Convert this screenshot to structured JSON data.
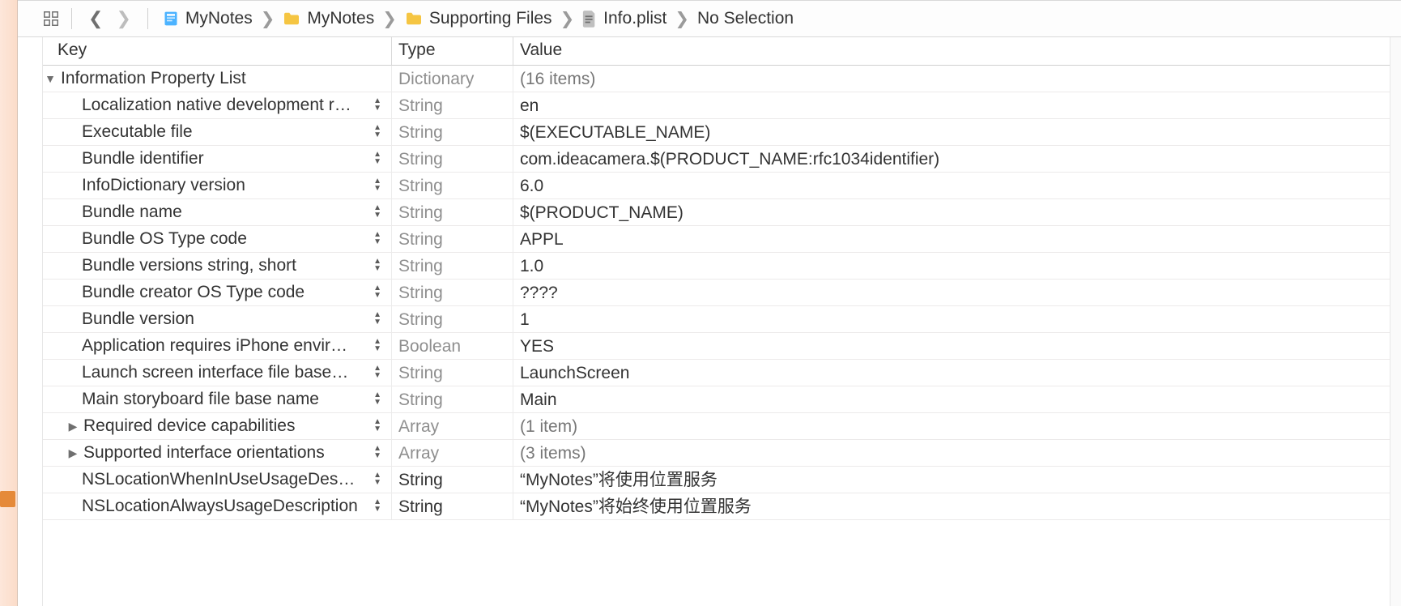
{
  "jumpbar": {
    "project": "MyNotes",
    "group": "MyNotes",
    "subgroup": "Supporting Files",
    "file": "Info.plist",
    "selection": "No Selection"
  },
  "columns": {
    "key": "Key",
    "type": "Type",
    "value": "Value"
  },
  "root": {
    "key": "Information Property List",
    "type": "Dictionary",
    "value": "(16 items)"
  },
  "rows": [
    {
      "key": "Localization native development r…",
      "type": "String",
      "value": "en",
      "stepper": true
    },
    {
      "key": "Executable file",
      "type": "String",
      "value": "$(EXECUTABLE_NAME)",
      "stepper": true
    },
    {
      "key": "Bundle identifier",
      "type": "String",
      "value": "com.ideacamera.$(PRODUCT_NAME:rfc1034identifier)",
      "stepper": true
    },
    {
      "key": "InfoDictionary version",
      "type": "String",
      "value": "6.0",
      "stepper": true
    },
    {
      "key": "Bundle name",
      "type": "String",
      "value": "$(PRODUCT_NAME)",
      "stepper": true
    },
    {
      "key": "Bundle OS Type code",
      "type": "String",
      "value": "APPL",
      "stepper": true
    },
    {
      "key": "Bundle versions string, short",
      "type": "String",
      "value": "1.0",
      "stepper": true
    },
    {
      "key": "Bundle creator OS Type code",
      "type": "String",
      "value": "????",
      "stepper": true
    },
    {
      "key": "Bundle version",
      "type": "String",
      "value": "1",
      "stepper": true
    },
    {
      "key": "Application requires iPhone envir…",
      "type": "Boolean",
      "value": "YES",
      "stepper": true
    },
    {
      "key": "Launch screen interface file base…",
      "type": "String",
      "value": "LaunchScreen",
      "stepper": true
    },
    {
      "key": "Main storyboard file base name",
      "type": "String",
      "value": "Main",
      "stepper": true
    },
    {
      "key": "Required device capabilities",
      "type": "Array",
      "value": "(1 item)",
      "stepper": true,
      "disclosure": "right",
      "muted": true
    },
    {
      "key": "Supported interface orientations",
      "type": "Array",
      "value": "(3 items)",
      "stepper": true,
      "disclosure": "right",
      "muted": true
    },
    {
      "key": "NSLocationWhenInUseUsageDes…",
      "type": "String",
      "value": "“MyNotes”将使用位置服务",
      "stepper": true,
      "typeBold": true
    },
    {
      "key": "NSLocationAlwaysUsageDescription",
      "type": "String",
      "value": "“MyNotes”将始终使用位置服务",
      "stepper": true,
      "typeBold": true
    }
  ]
}
